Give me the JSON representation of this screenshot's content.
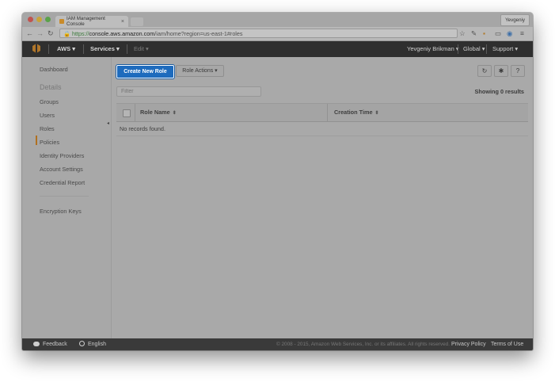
{
  "browser": {
    "tab_title": "IAM Management Console",
    "tab_close": "×",
    "profile_name": "Yevgeniy",
    "url_scheme": "https://",
    "url_domain": "console.aws.amazon.com",
    "url_path": "/iam/home?region=us-east-1#roles",
    "icons": [
      "back-icon",
      "forward-icon",
      "reload-icon",
      "lock-icon",
      "star-icon",
      "extension-icon",
      "cast-icon",
      "menu-icon"
    ]
  },
  "aws_nav": {
    "brand": "AWS",
    "services": "Services",
    "edit": "Edit",
    "user": "Yevgeniy Brikman",
    "region": "Global",
    "support": "Support",
    "caret": "▾"
  },
  "sidebar": {
    "dashboard": "Dashboard",
    "details_heading": "Details",
    "items": [
      "Groups",
      "Users",
      "Roles",
      "Policies",
      "Identity Providers",
      "Account Settings",
      "Credential Report"
    ],
    "active_item": "Roles",
    "encryption_keys": "Encryption Keys"
  },
  "toolbar": {
    "create_label": "Create New Role",
    "actions_label": "Role Actions",
    "actions_caret": "▾"
  },
  "filter": {
    "placeholder": "Filter"
  },
  "results": {
    "showing": "Showing 0 results"
  },
  "table": {
    "columns": [
      "Role Name",
      "Creation Time"
    ],
    "sort_glyph": "⬍",
    "empty_message": "No records found."
  },
  "footer": {
    "feedback": "Feedback",
    "language": "English",
    "copyright": "© 2008 - 2015, Amazon Web Services, Inc. or its affiliates. All rights reserved.",
    "privacy": "Privacy Policy",
    "terms": "Terms of Use"
  },
  "colors": {
    "primary_button": "#1e6bbd",
    "nav_bar": "#2f2f2f",
    "active_indicator": "#b07020"
  }
}
